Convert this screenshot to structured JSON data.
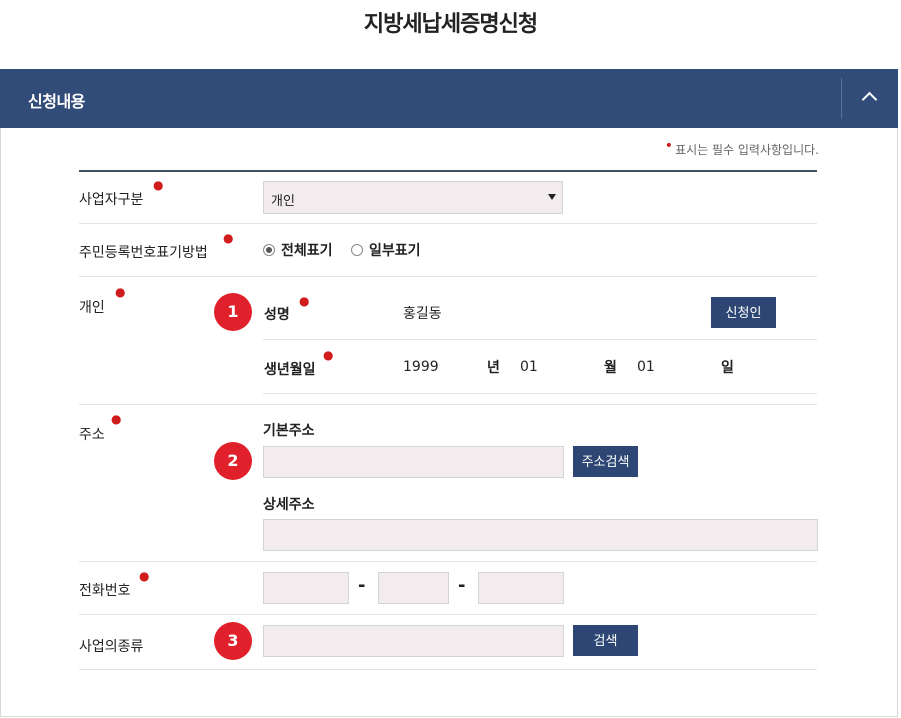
{
  "page": {
    "title": "지방세납세증명신청"
  },
  "section": {
    "title": "신청내용"
  },
  "required_note": "표시는 필수 입력사항입니다.",
  "rows": {
    "business_type": {
      "label": "사업자구분",
      "select_value": "개인"
    },
    "id_display": {
      "label": "주민등록번호표기방법",
      "options": [
        "전체표기",
        "일부표기"
      ],
      "selected": "전체표기"
    },
    "individual": {
      "label": "개인",
      "name_label": "성명",
      "name_value": "홍길동",
      "applicant_button": "신청인",
      "birth_label": "생년월일",
      "birth_year": "1999",
      "year_unit": "년",
      "birth_month": "01",
      "month_unit": "월",
      "birth_day": "01",
      "day_unit": "일"
    },
    "address": {
      "label": "주소",
      "basic_label": "기본주소",
      "search_button": "주소검색",
      "detail_label": "상세주소"
    },
    "phone": {
      "label": "전화번호",
      "sep": "-"
    },
    "business_kind": {
      "label": "사업의종류",
      "search_button": "검색"
    }
  },
  "badges": [
    "1",
    "2",
    "3"
  ],
  "colors": {
    "header": "#324c7a",
    "button": "#2d4673",
    "badge": "#e0202a",
    "required": "#d01c1c",
    "input_bg": "#f3ecee"
  }
}
